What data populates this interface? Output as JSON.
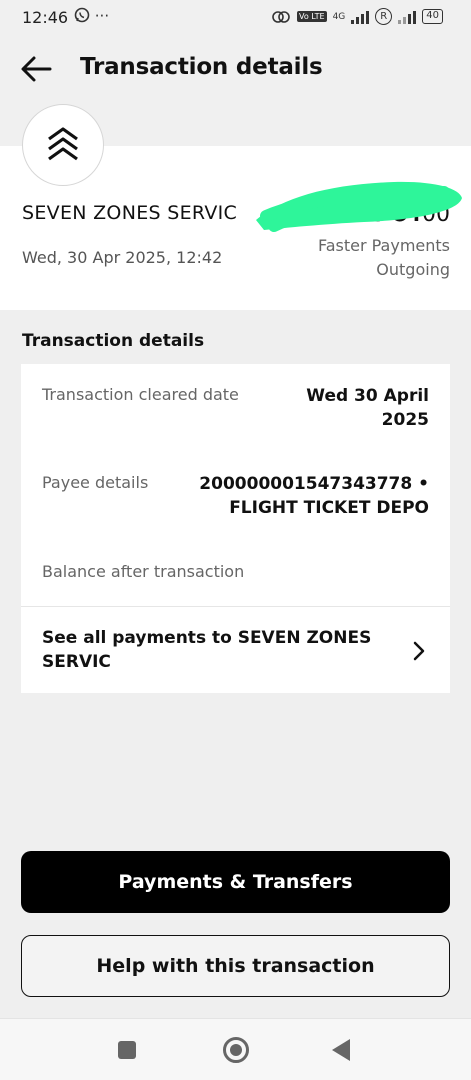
{
  "status_bar": {
    "time": "12:46",
    "left_icons": [
      "whatsapp-icon",
      "more-dots-icon"
    ],
    "dots": "···",
    "network": "4G",
    "volte": "Vo LTE",
    "roaming": "R",
    "battery": "40"
  },
  "header": {
    "title": "Transaction details",
    "back_icon": "arrow-left-icon"
  },
  "summary": {
    "logo_icon": "chevron-stack-icon",
    "merchant": "SEVEN ZONES SERVIC",
    "datetime": "Wed, 30 Apr 2025, 12:42",
    "amount_main": "- £400.",
    "amount_pence": "00",
    "payment_type_line1": "Faster Payments",
    "payment_type_line2": "Outgoing"
  },
  "details": {
    "section_title": "Transaction details",
    "cleared_label": "Transaction cleared date",
    "cleared_value_line1": "Wed 30 April",
    "cleared_value_line2": "2025",
    "payee_label": "Payee details",
    "payee_value_line1": "200000001547343778 •",
    "payee_value_line2": "FLIGHT TICKET DEPO",
    "balance_label": "Balance after transaction",
    "redaction_color": "#2ef59a",
    "see_all_line1": "See all payments to SEVEN ZONES",
    "see_all_line2": "SERVIC"
  },
  "buttons": {
    "payments_transfers": "Payments & Transfers",
    "help": "Help with this transaction"
  },
  "nav_bar": {
    "icons": [
      "recents-square-icon",
      "home-circle-icon",
      "back-triangle-icon"
    ]
  }
}
